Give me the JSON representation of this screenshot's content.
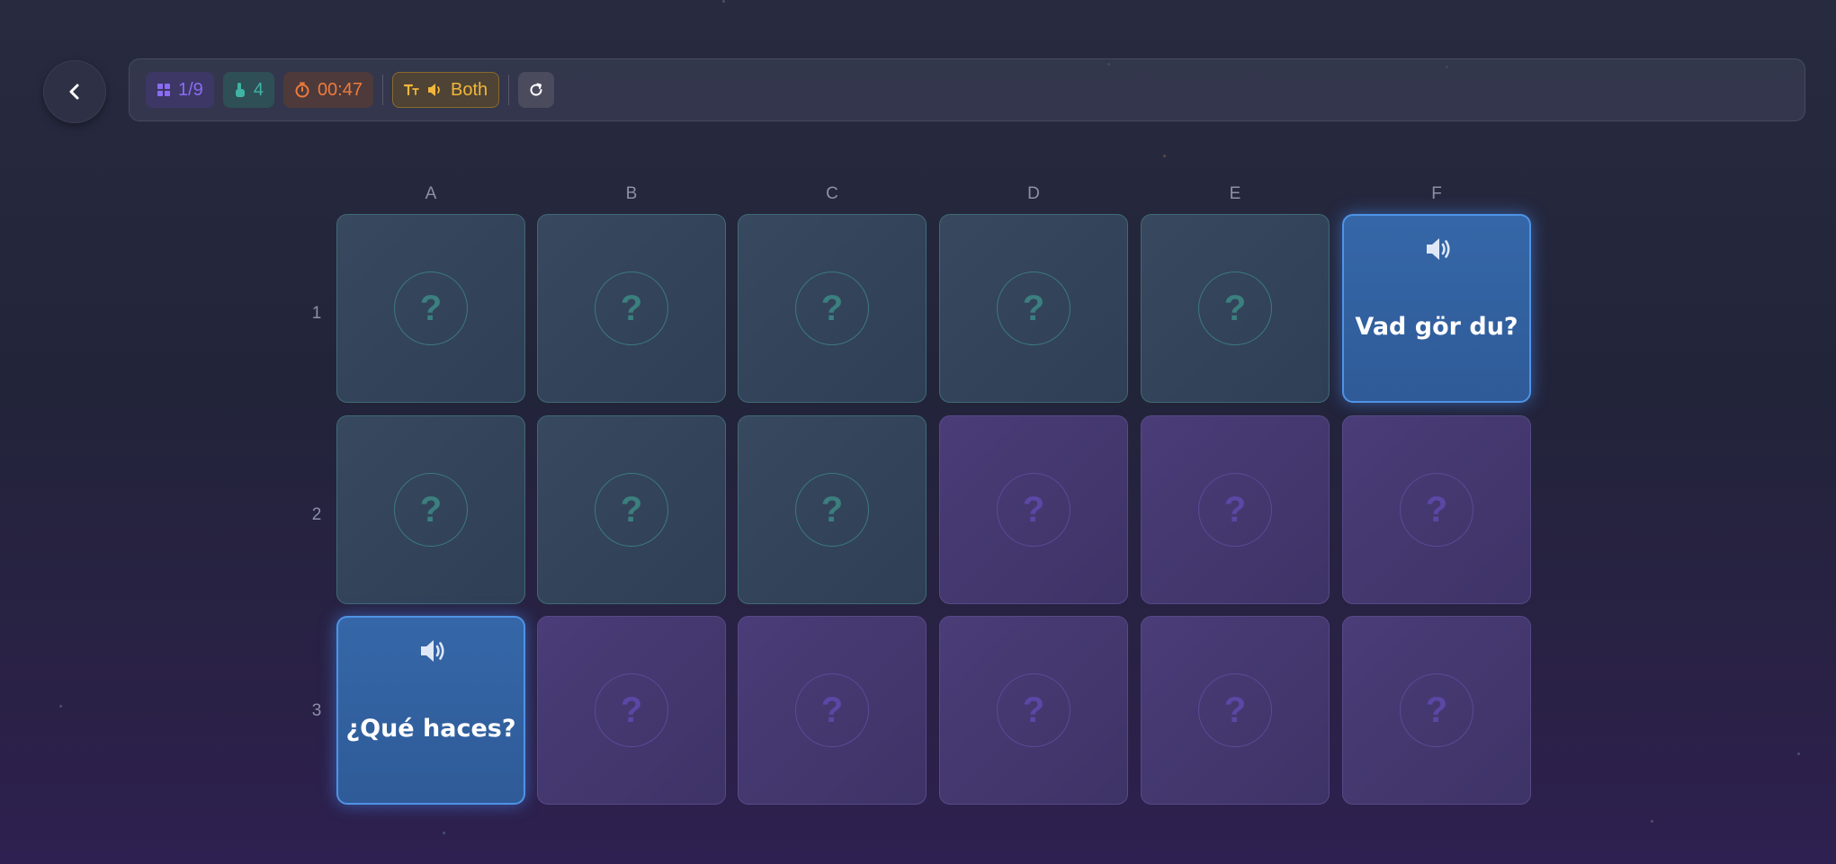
{
  "toolbar": {
    "pairs": "1/9",
    "moves": "4",
    "timer": "00:47",
    "mode": "Both"
  },
  "grid": {
    "columns": [
      "A",
      "B",
      "C",
      "D",
      "E",
      "F"
    ],
    "rows": [
      "1",
      "2",
      "3"
    ]
  },
  "cards": {
    "f1": {
      "text": "Vad gör du?"
    },
    "a3": {
      "text": "¿Qué haces?"
    }
  },
  "hidden_glyph": "?",
  "colors": {
    "teal_side": "#37485f",
    "purple_side": "#4a3c78",
    "open_card": "#3567a8",
    "pairs_accent": "#8b6cf2",
    "moves_accent": "#3fb4a4",
    "timer_accent": "#ee7b3a",
    "mode_accent": "#f2b63c"
  }
}
